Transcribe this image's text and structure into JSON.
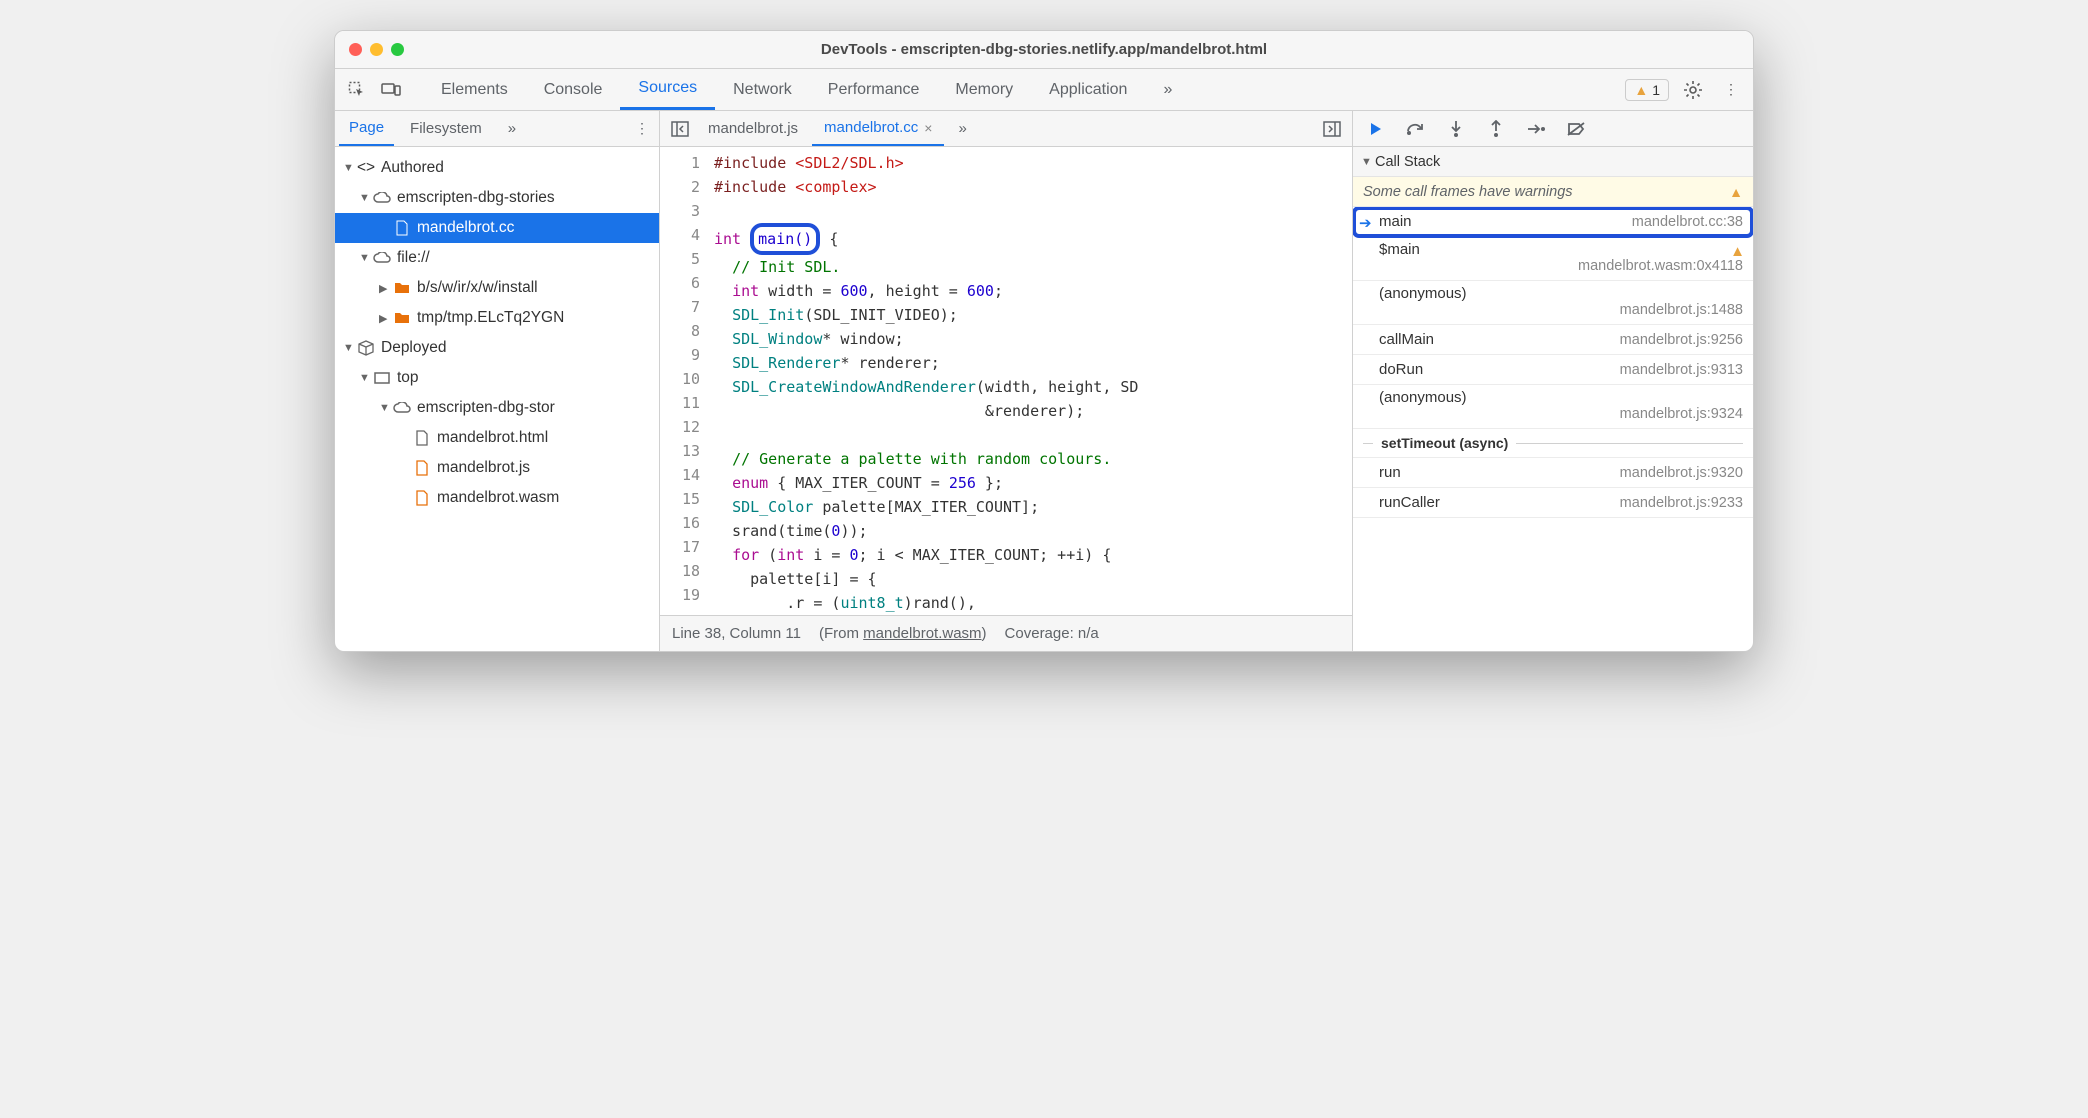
{
  "window": {
    "title": "DevTools - emscripten-dbg-stories.netlify.app/mandelbrot.html"
  },
  "toolbar": {
    "tabs": [
      "Elements",
      "Console",
      "Sources",
      "Network",
      "Performance",
      "Memory",
      "Application"
    ],
    "active_index": 2,
    "overflow_glyph": "»",
    "warning_count": "1"
  },
  "left": {
    "tabs": [
      "Page",
      "Filesystem"
    ],
    "active_index": 0,
    "overflow_glyph": "»",
    "tree": {
      "authored_label": "Authored",
      "authored_children": [
        {
          "label": "emscripten-dbg-stories",
          "children": [
            {
              "label": "mandelbrot.cc",
              "selected": true
            }
          ]
        },
        {
          "label": "file://",
          "children": [
            {
              "label": "b/s/w/ir/x/w/install"
            },
            {
              "label": "tmp/tmp.ELcTq2YGN"
            }
          ]
        }
      ],
      "deployed_label": "Deployed",
      "deployed_children": [
        {
          "label": "top",
          "children": [
            {
              "label": "emscripten-dbg-stor",
              "children": [
                {
                  "label": "mandelbrot.html"
                },
                {
                  "label": "mandelbrot.js"
                },
                {
                  "label": "mandelbrot.wasm"
                }
              ]
            }
          ]
        }
      ]
    }
  },
  "editor": {
    "tabs": [
      {
        "label": "mandelbrot.js",
        "active": false
      },
      {
        "label": "mandelbrot.cc",
        "active": true,
        "closable": true
      }
    ],
    "overflow_glyph": "»",
    "code_lines": [
      "#include <SDL2/SDL.h>",
      "#include <complex>",
      "",
      "int main() {",
      "  // Init SDL.",
      "  int width = 600, height = 600;",
      "  SDL_Init(SDL_INIT_VIDEO);",
      "  SDL_Window* window;",
      "  SDL_Renderer* renderer;",
      "  SDL_CreateWindowAndRenderer(width, height, SD",
      "                              &renderer);",
      "",
      "  // Generate a palette with random colours.",
      "  enum { MAX_ITER_COUNT = 256 };",
      "  SDL_Color palette[MAX_ITER_COUNT];",
      "  srand(time(0));",
      "  for (int i = 0; i < MAX_ITER_COUNT; ++i) {",
      "    palette[i] = {",
      "        .r = (uint8_t)rand(),"
    ],
    "status": {
      "position": "Line 38, Column 11",
      "from_prefix": "(From ",
      "from_link": "mandelbrot.wasm",
      "from_suffix": ")",
      "coverage": "Coverage: n/a"
    }
  },
  "debugger": {
    "section_title": "Call Stack",
    "warning_text": "Some call frames have warnings",
    "frames": [
      {
        "name": "main",
        "location": "mandelbrot.cc:38",
        "current": true,
        "pointer": true
      },
      {
        "name": "$main",
        "location": "mandelbrot.wasm:0x4118",
        "warn": true
      },
      {
        "name": "(anonymous)",
        "location": "mandelbrot.js:1488"
      },
      {
        "name": "callMain",
        "location": "mandelbrot.js:9256",
        "single": true
      },
      {
        "name": "doRun",
        "location": "mandelbrot.js:9313",
        "single": true
      },
      {
        "name": "(anonymous)",
        "location": "mandelbrot.js:9324"
      }
    ],
    "async_label": "setTimeout (async)",
    "async_frames": [
      {
        "name": "run",
        "location": "mandelbrot.js:9320",
        "single": true
      },
      {
        "name": "runCaller",
        "location": "mandelbrot.js:9233",
        "single": true
      }
    ]
  }
}
